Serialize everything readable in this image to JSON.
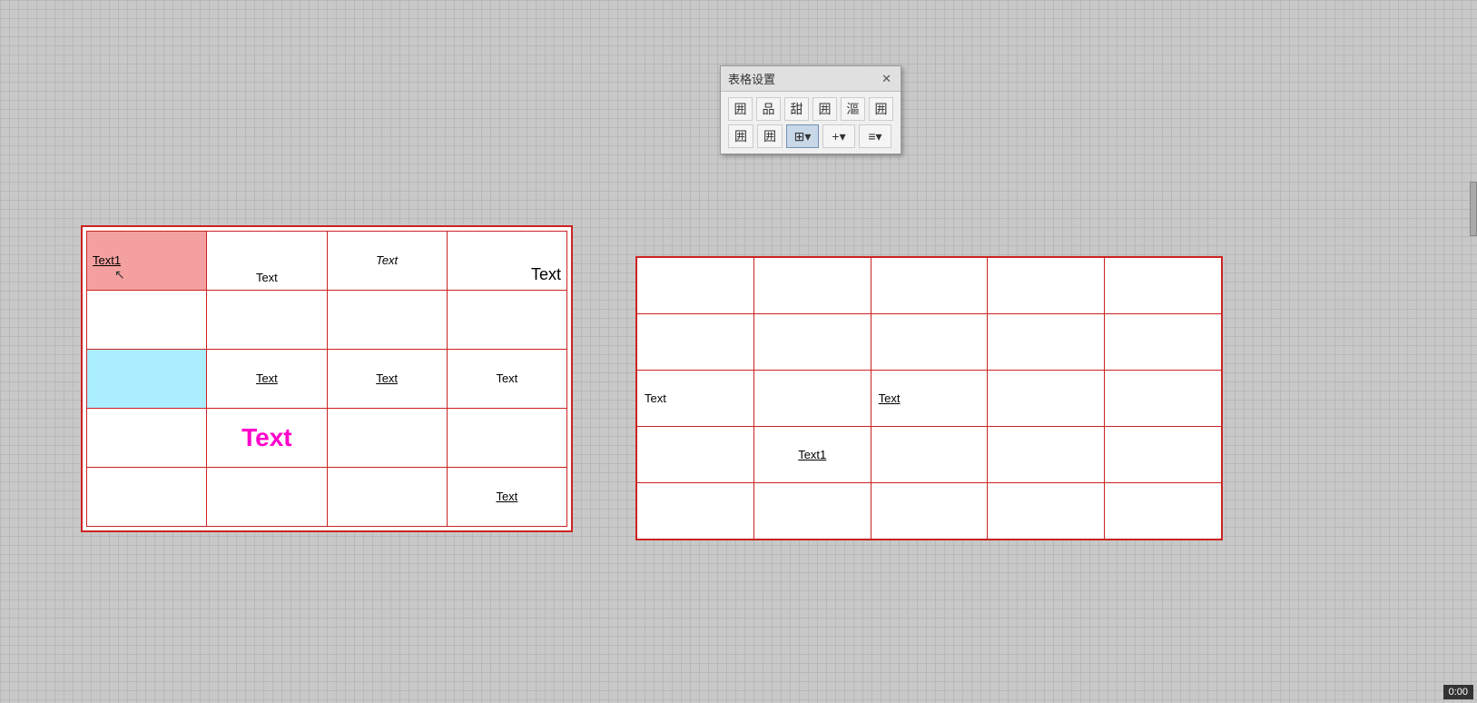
{
  "dialog": {
    "title": "表格设置",
    "close_label": "✕",
    "buttons_row1": [
      {
        "label": "囲",
        "name": "border-all",
        "active": false
      },
      {
        "label": "品",
        "name": "border-outside",
        "active": false
      },
      {
        "label": "甜",
        "name": "border-inside",
        "active": false
      },
      {
        "label": "囲",
        "name": "border-top",
        "active": false
      },
      {
        "label": "漚",
        "name": "border-bottom-heavy",
        "active": false
      },
      {
        "label": "囲",
        "name": "border-option6",
        "active": false
      }
    ],
    "buttons_row2": [
      {
        "label": "囲",
        "name": "border-type1",
        "active": false
      },
      {
        "label": "囲",
        "name": "border-type2",
        "active": false
      },
      {
        "label": "⊞▾",
        "name": "border-style-dropdown",
        "active": true,
        "wide": true
      },
      {
        "label": "+▾",
        "name": "border-color-dropdown",
        "active": false,
        "wide": true
      },
      {
        "label": "≡▾",
        "name": "text-align-dropdown",
        "active": false,
        "wide": true
      }
    ]
  },
  "left_table": {
    "rows": [
      [
        {
          "text": "Text1",
          "style": "underline",
          "bg": "selected",
          "align": "left"
        },
        {
          "text": "Text",
          "style": "none",
          "bg": "none",
          "align": "center-bottom"
        },
        {
          "text": "Text",
          "style": "italic",
          "bg": "none",
          "align": "center"
        },
        {
          "text": "Text",
          "style": "none",
          "bg": "none",
          "align": "right-bottom"
        }
      ],
      [
        {
          "text": "",
          "style": "none",
          "bg": "none"
        },
        {
          "text": "",
          "style": "none",
          "bg": "none"
        },
        {
          "text": "",
          "style": "none",
          "bg": "none"
        },
        {
          "text": "",
          "style": "none",
          "bg": "none"
        }
      ],
      [
        {
          "text": "",
          "style": "none",
          "bg": "cyan"
        },
        {
          "text": "Text",
          "style": "underline",
          "bg": "none",
          "align": "center"
        },
        {
          "text": "Text",
          "style": "underline",
          "bg": "none",
          "align": "center"
        },
        {
          "text": "Text",
          "style": "none",
          "bg": "none",
          "align": "center"
        }
      ],
      [
        {
          "text": "",
          "style": "none",
          "bg": "none"
        },
        {
          "text": "Text",
          "style": "none",
          "bg": "none",
          "align": "center",
          "color": "magenta",
          "big": true
        },
        {
          "text": "",
          "style": "none",
          "bg": "none"
        },
        {
          "text": "",
          "style": "none",
          "bg": "none"
        }
      ],
      [
        {
          "text": "",
          "style": "none",
          "bg": "none"
        },
        {
          "text": "",
          "style": "none",
          "bg": "none"
        },
        {
          "text": "",
          "style": "none",
          "bg": "none"
        },
        {
          "text": "Text",
          "style": "underline",
          "bg": "none",
          "align": "center"
        }
      ]
    ]
  },
  "right_table": {
    "rows": [
      [
        "",
        "",
        "",
        "",
        ""
      ],
      [
        "",
        "",
        "",
        "",
        ""
      ],
      [
        "Text",
        "",
        "Text",
        "",
        ""
      ],
      [
        "",
        "Text1",
        "",
        "",
        ""
      ],
      [
        "",
        "",
        "",
        "",
        ""
      ]
    ],
    "cell_styles": {
      "2_0": "normal",
      "2_2": "underline",
      "3_1": "underline"
    }
  },
  "clock": "0:00",
  "cursor": "↖"
}
